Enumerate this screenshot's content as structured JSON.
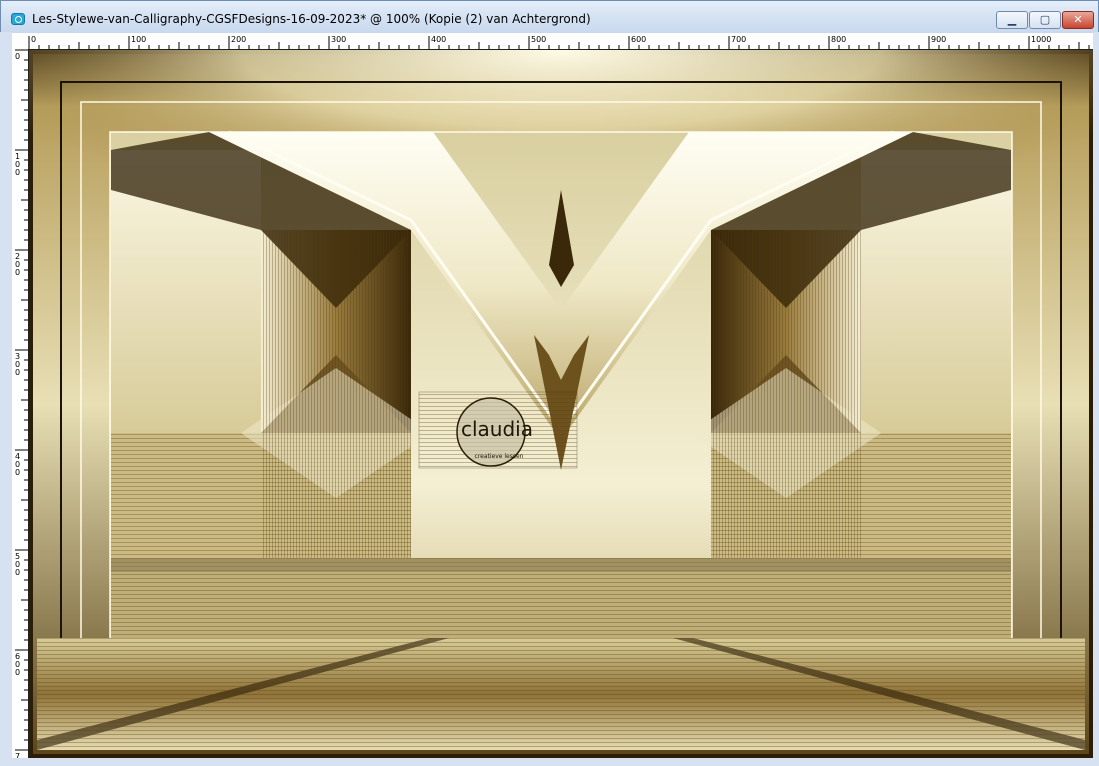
{
  "window": {
    "title": "Les-Stylewe-van-Calligraphy-CGSFDesigns-16-09-2023* @ 100% (Kopie (2) van Achtergrond)",
    "app_icon": "paintshop-pro-icon",
    "controls": {
      "minimize_glyph": "▁",
      "maximize_glyph": "▢",
      "close_glyph": "✕"
    }
  },
  "ruler": {
    "top_labels": [
      "0",
      "100",
      "200",
      "300",
      "400",
      "500",
      "600",
      "700",
      "800",
      "900",
      "1000"
    ],
    "left_labels": [
      "0",
      "100",
      "200",
      "300",
      "400",
      "500",
      "600",
      "700"
    ]
  },
  "artwork": {
    "watermark_text": "claudia",
    "watermark_subtext": "creatieve lessen",
    "palette": {
      "dark_bronze": "#3d2a0a",
      "gold": "#a88a46",
      "cream": "#ece4bf",
      "highlight": "#fffdf0"
    }
  }
}
